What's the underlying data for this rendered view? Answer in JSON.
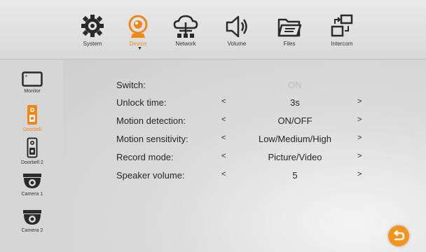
{
  "tabs": [
    {
      "label": "System",
      "icon": "gear-icon"
    },
    {
      "label": "Device",
      "icon": "camera-icon",
      "active": true
    },
    {
      "label": "Network",
      "icon": "network-cloud-icon"
    },
    {
      "label": "Volume",
      "icon": "speaker-icon"
    },
    {
      "label": "Files",
      "icon": "folder-icon"
    },
    {
      "label": "Intercom",
      "icon": "intercom-icon"
    }
  ],
  "sidebar": [
    {
      "label": "Monitor",
      "icon": "monitor-icon"
    },
    {
      "label": "Doorbell",
      "icon": "doorbell-icon",
      "active": true
    },
    {
      "label": "Doorbell 2",
      "icon": "doorbell-icon"
    },
    {
      "label": "Camera 1",
      "icon": "dome-camera-icon"
    },
    {
      "label": "Camera 2",
      "icon": "dome-camera-icon"
    }
  ],
  "settings": [
    {
      "label": "Switch:",
      "value": "ON",
      "left_arrow": "",
      "right_arrow": ""
    },
    {
      "label": "Unlock time:",
      "value": "3s",
      "left_arrow": "<",
      "right_arrow": ">"
    },
    {
      "label": "Motion detection:",
      "value": "ON/OFF",
      "left_arrow": "<",
      "right_arrow": ">"
    },
    {
      "label": "Motion sensitivity:",
      "value": "Low/Medium/High",
      "left_arrow": "<",
      "right_arrow": ">"
    },
    {
      "label": "Record mode:",
      "value": "Picture/Video",
      "left_arrow": "<",
      "right_arrow": ">"
    },
    {
      "label": "Speaker volume:",
      "value": "5",
      "left_arrow": "<",
      "right_arrow": ">"
    }
  ],
  "colors": {
    "accent": "#f0871a",
    "text": "#262626",
    "disabled": "#bdbdbd"
  }
}
